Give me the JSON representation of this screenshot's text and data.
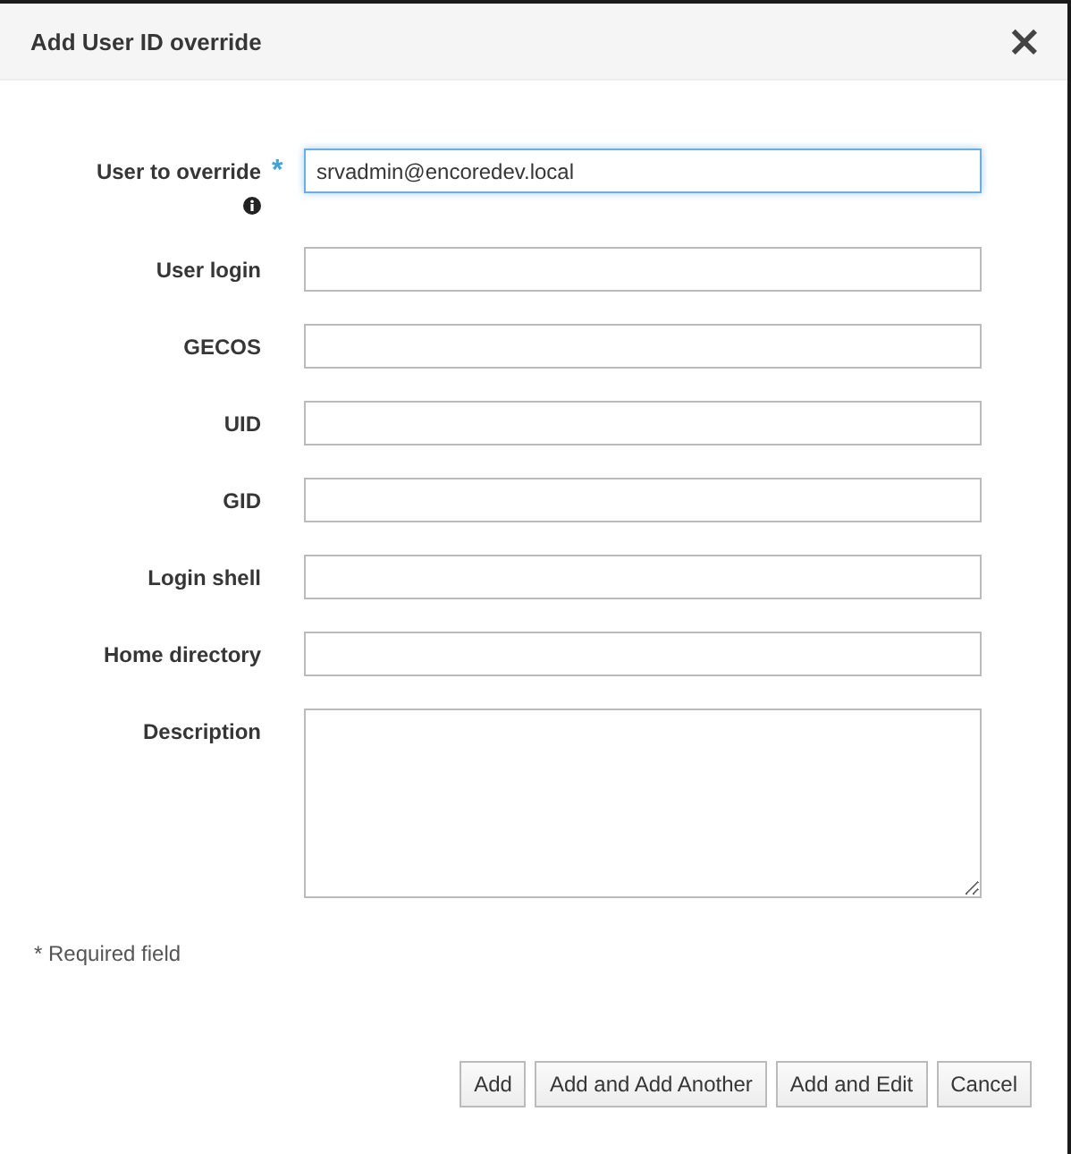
{
  "dialog": {
    "title": "Add User ID override",
    "close": "×"
  },
  "fields": [
    {
      "label": "User to override",
      "kind": "text",
      "required_mark": "*",
      "info": true,
      "focused": true,
      "value": "srvadmin@encoredev.local"
    },
    {
      "label": "User login",
      "kind": "text",
      "focused": false
    },
    {
      "label": "GECOS",
      "kind": "text",
      "focused": false
    },
    {
      "label": "UID",
      "kind": "text",
      "focused": false
    },
    {
      "label": "GID",
      "kind": "text",
      "focused": false
    },
    {
      "label": "Login shell",
      "kind": "text",
      "focused": false
    },
    {
      "label": "Home directory",
      "kind": "text",
      "focused": false
    },
    {
      "label": "Description",
      "kind": "textarea",
      "focused": false
    }
  ],
  "required_note": "* Required field",
  "buttons": [
    "Add",
    "Add and Add Another",
    "Add and Edit",
    "Cancel"
  ]
}
